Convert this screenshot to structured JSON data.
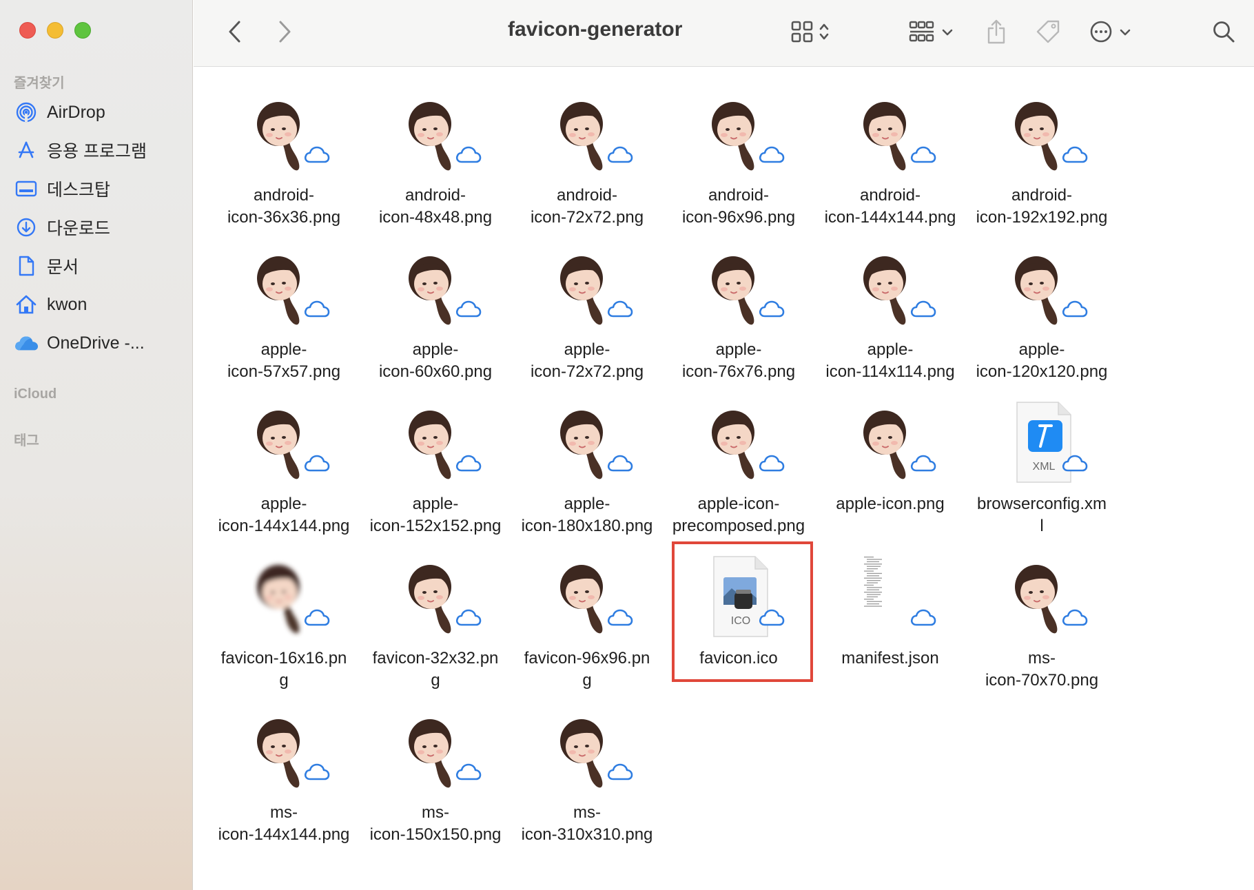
{
  "window": {
    "title": "favicon-generator"
  },
  "sidebar": {
    "favorites_header": "즐겨찾기",
    "items": [
      {
        "label": "AirDrop",
        "icon": "airdrop-icon"
      },
      {
        "label": "응용 프로그램",
        "icon": "applications-icon"
      },
      {
        "label": "데스크탑",
        "icon": "desktop-icon"
      },
      {
        "label": "다운로드",
        "icon": "downloads-icon"
      },
      {
        "label": "문서",
        "icon": "documents-icon"
      },
      {
        "label": "kwon",
        "icon": "home-icon"
      },
      {
        "label": "OneDrive -...",
        "icon": "onedrive-cloud-icon"
      }
    ],
    "icloud_header": "iCloud",
    "tags_header": "태그"
  },
  "toolbar": {
    "back_icon": "chevron-left-icon",
    "forward_icon": "chevron-right-icon",
    "view_icon": "grid-view-icon",
    "group_icon": "group-icon",
    "share_icon": "share-icon",
    "tag_icon": "tag-icon",
    "action_icon": "ellipsis-circle-icon",
    "search_icon": "search-icon"
  },
  "files": [
    {
      "name": "android-\nicon-36x36.png",
      "kind": "avatar"
    },
    {
      "name": "android-\nicon-48x48.png",
      "kind": "avatar"
    },
    {
      "name": "android-\nicon-72x72.png",
      "kind": "avatar"
    },
    {
      "name": "android-\nicon-96x96.png",
      "kind": "avatar"
    },
    {
      "name": "android-\nicon-144x144.png",
      "kind": "avatar"
    },
    {
      "name": "android-\nicon-192x192.png",
      "kind": "avatar"
    },
    {
      "name": "apple-\nicon-57x57.png",
      "kind": "avatar"
    },
    {
      "name": "apple-\nicon-60x60.png",
      "kind": "avatar"
    },
    {
      "name": "apple-\nicon-72x72.png",
      "kind": "avatar"
    },
    {
      "name": "apple-\nicon-76x76.png",
      "kind": "avatar"
    },
    {
      "name": "apple-\nicon-114x114.png",
      "kind": "avatar"
    },
    {
      "name": "apple-\nicon-120x120.png",
      "kind": "avatar"
    },
    {
      "name": "apple-\nicon-144x144.png",
      "kind": "avatar"
    },
    {
      "name": "apple-\nicon-152x152.png",
      "kind": "avatar"
    },
    {
      "name": "apple-\nicon-180x180.png",
      "kind": "avatar"
    },
    {
      "name": "apple-icon-\nprecomposed.png",
      "kind": "avatar"
    },
    {
      "name": "apple-icon.png",
      "kind": "avatar"
    },
    {
      "name": "browserconfig.xm\nl",
      "kind": "xml",
      "badge": "XML"
    },
    {
      "name": "favicon-16x16.pn\ng",
      "kind": "avatar-blur"
    },
    {
      "name": "favicon-32x32.pn\ng",
      "kind": "avatar"
    },
    {
      "name": "favicon-96x96.pn\ng",
      "kind": "avatar"
    },
    {
      "name": "favicon.ico",
      "kind": "ico",
      "badge": "ICO"
    },
    {
      "name": "manifest.json",
      "kind": "json"
    },
    {
      "name": "ms-\nicon-70x70.png",
      "kind": "avatar"
    },
    {
      "name": "ms-\nicon-144x144.png",
      "kind": "avatar"
    },
    {
      "name": "ms-\nicon-150x150.png",
      "kind": "avatar"
    },
    {
      "name": "ms-\nicon-310x310.png",
      "kind": "avatar"
    }
  ],
  "selected_file": "favicon.ico",
  "colors": {
    "highlight": "#e0473a",
    "cloud": "#2f7de1",
    "sidebar_accent": "#3478f6"
  }
}
